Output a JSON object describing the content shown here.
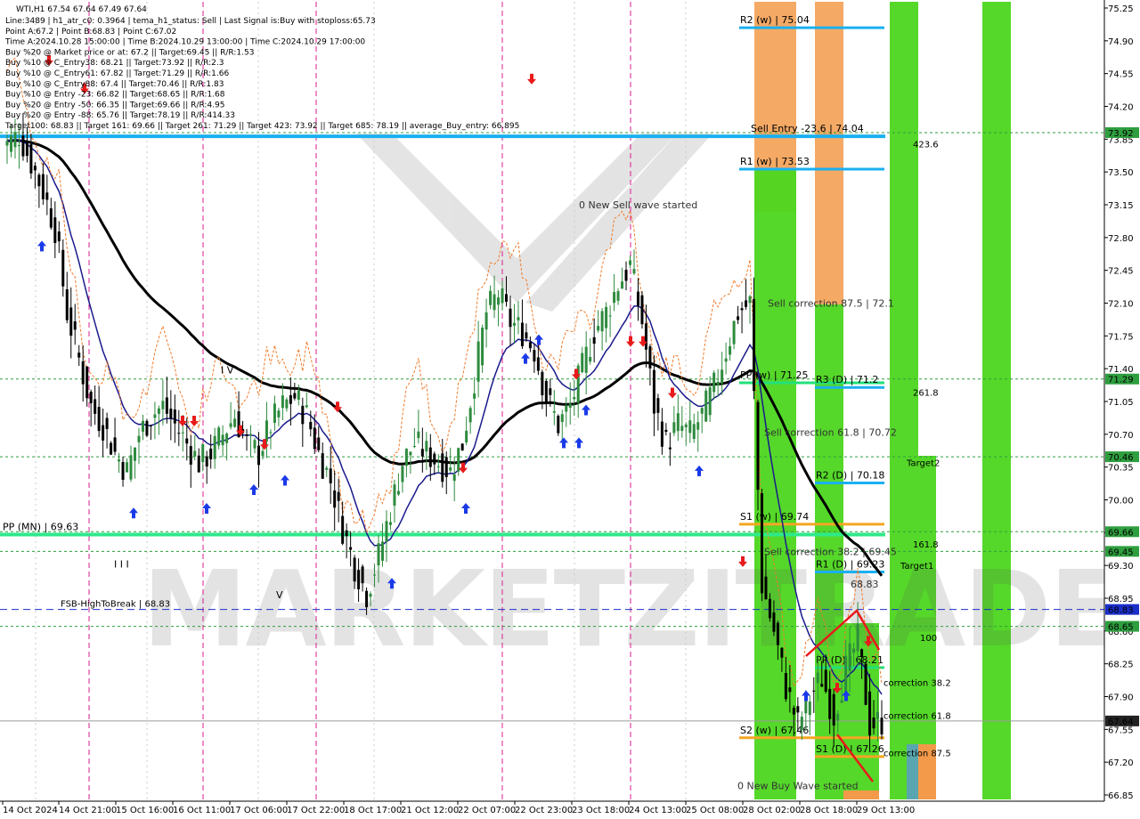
{
  "header": {
    "symbol_line": "WTI,H1 67.54 67.64 67.49 67.64",
    "info_lines": [
      "Line:3489 | h1_atr_c0: 0.3964 | tema_h1_status: Sell | Last Signal is:Buy with stoploss:65.73",
      "Point A:67.2 | Point B:68.83 | Point C:67.02",
      "Time A:2024.10.28 15:00:00 | Time B:2024.10.29 13:00:00 | Time C:2024.10.29 17:00:00",
      "Buy %20 @ Market price or at: 67.2 || Target:69.45 || R/R:1.53",
      "Buy %10 @ C_Entry38: 68.21 || Target:73.92 || R/R:2.3",
      "Buy %10 @ C_Entry61: 67.82 || Target:71.29 || R/R:1.66",
      "Buy %10 @ C_Entry88: 67.4 || Target:70.46 || R/R:1.83",
      "Buy %10 @ Entry -23: 66.82 || Target:68.65 || R/R:1.68",
      "Buy %20 @ Entry -50: 66.35 || Target:69.66 || R/R:4.95",
      "Buy %20 @ Entry -88: 65.76 || Target:78.19 || R/R:414.33",
      "Target100: 68.83 || Target 161: 69.66 || Target 261: 71.29 || Target 423: 73.92 || Target 685: 78.19 || average_Buy_entry: 66.895"
    ]
  },
  "chart_data": {
    "type": "candlestick",
    "instrument": "WTI",
    "timeframe": "H1",
    "price_axis": {
      "ticks": [
        75.25,
        74.9,
        74.55,
        74.2,
        73.85,
        73.5,
        73.15,
        72.8,
        72.45,
        72.1,
        71.75,
        71.4,
        71.05,
        70.7,
        70.35,
        70.0,
        69.65,
        69.3,
        68.95,
        68.6,
        68.25,
        67.9,
        67.55,
        67.2,
        66.85
      ],
      "range": [
        66.85,
        75.25
      ]
    },
    "time_axis": {
      "labels": [
        "14 Oct 2024",
        "14 Oct 21:00",
        "15 Oct 16:00",
        "16 Oct 11:00",
        "17 Oct 06:00",
        "17 Oct 22:00",
        "18 Oct 17:00",
        "21 Oct 12:00",
        "22 Oct 07:00",
        "22 Oct 23:00",
        "23 Oct 18:00",
        "24 Oct 13:00",
        "25 Oct 08:00",
        "28 Oct 02:00",
        "28 Oct 18:00",
        "29 Oct 13:00"
      ]
    },
    "close_series": [
      73.8,
      73.9,
      73.6,
      73.3,
      72.9,
      72.0,
      71.5,
      71.0,
      70.8,
      70.5,
      70.3,
      70.7,
      70.9,
      71.0,
      70.8,
      70.6,
      70.4,
      70.5,
      70.7,
      70.9,
      70.6,
      70.5,
      70.8,
      71.0,
      71.1,
      70.9,
      70.5,
      70.2,
      69.7,
      69.3,
      69.0,
      69.4,
      69.9,
      70.4,
      70.6,
      70.5,
      70.4,
      70.3,
      70.6,
      71.3,
      72.0,
      72.2,
      71.9,
      71.8,
      71.6,
      71.1,
      70.8,
      71.0,
      71.4,
      71.8,
      72.0,
      72.3,
      72.5,
      71.9,
      71.0,
      70.6,
      70.8,
      70.7,
      70.9,
      71.2,
      71.6,
      72.0,
      72.1,
      69.1,
      68.6,
      68.0,
      67.6,
      67.9,
      68.1,
      67.7,
      68.2,
      68.5,
      67.6,
      67.64
    ],
    "horizontal_levels": [
      {
        "label": "R2 (w) | 75.04",
        "value": 75.04,
        "color": "#1ab0f0"
      },
      {
        "label": "R1 (w) | 73.53",
        "value": 73.53,
        "color": "#1ab0f0"
      },
      {
        "label": "PP (w) | 71.25",
        "value": 71.25,
        "color": "#22e07a"
      },
      {
        "label": "R3 (D) | 71.2",
        "value": 71.2,
        "color": "#1ab0f0"
      },
      {
        "label": "R2 (D) | 70.18",
        "value": 70.18,
        "color": "#1ab0f0"
      },
      {
        "label": "S1 (w) | 69.74",
        "value": 69.74,
        "color": "#f5a623"
      },
      {
        "label": "R1 (D) | 69.23",
        "value": 69.23,
        "color": "#1ab0f0"
      },
      {
        "label": "PP (D) | 68.21",
        "value": 68.21,
        "color": "#22e07a"
      },
      {
        "label": "S2 (w) | 67.46",
        "value": 67.46,
        "color": "#f5a623"
      },
      {
        "label": "S1 (D) | 67.26",
        "value": 67.26,
        "color": "#f5a623"
      }
    ],
    "wide_lines": [
      {
        "label": "PP (MN) | 69.63",
        "value": 69.63,
        "color": "#2ee88a"
      },
      {
        "label": "Sell Entry -23.6 | 74.04",
        "value": 73.88,
        "color": "#1ab0f0"
      }
    ],
    "dotted_levels": [
      73.92,
      71.29,
      70.46,
      69.66,
      69.45,
      68.65
    ],
    "dashed_level": {
      "label": "FSB-HighToBreak | 68.83",
      "value": 68.83
    },
    "price_badges": [
      {
        "label": "73.92",
        "value": 73.92,
        "color": "#2e9e3e"
      },
      {
        "label": "71.29",
        "value": 71.29,
        "color": "#2e9e3e"
      },
      {
        "label": "70.46",
        "value": 70.46,
        "color": "#2e9e3e"
      },
      {
        "label": "69.66",
        "value": 69.66,
        "color": "#2e9e3e"
      },
      {
        "label": "69.45",
        "value": 69.45,
        "color": "#2e9e3e"
      },
      {
        "label": "68.83",
        "value": 68.83,
        "color": "#1a2ec8"
      },
      {
        "label": "68.65",
        "value": 68.65,
        "color": "#2e9e3e"
      },
      {
        "label": "67.64",
        "value": 67.64,
        "color": "#222222"
      }
    ],
    "annotations": [
      {
        "text": "0 New Sell wave started",
        "price": 73.15
      },
      {
        "text": "Sell correction 87.5 | 72.1",
        "price": 72.1
      },
      {
        "text": "Sell correction 61.8 | 70.72",
        "price": 70.72
      },
      {
        "text": "Sell correction 38.2 | 69.45",
        "price": 69.45
      },
      {
        "text": "68.83",
        "price": 69.1
      },
      {
        "text": "correction 38.2",
        "price": 68.05
      },
      {
        "text": "correction 61.8",
        "price": 67.7
      },
      {
        "text": "correction 87.5",
        "price": 67.3
      },
      {
        "text": "0 New Buy Wave started",
        "price": 66.95
      }
    ],
    "target_labels": [
      {
        "text": "423.6",
        "price": 73.8
      },
      {
        "text": "261.8",
        "price": 71.15
      },
      {
        "text": "Target2",
        "price": 70.4
      },
      {
        "text": "161.8",
        "price": 69.53
      },
      {
        "text": "Target1",
        "price": 69.3
      },
      {
        "text": "100",
        "price": 68.53
      }
    ],
    "fib_marks": [
      "I V",
      "I I I",
      "V"
    ]
  },
  "watermark": {
    "text": "MARKETZITRADE"
  },
  "colors": {
    "bull_candle": "#2e8b3e",
    "bear_candle": "#000000",
    "ma_slow": "#000000",
    "ma_fast": "#1a1a8c",
    "orange_dashed": "#f07a2a",
    "buy_arrow": "#1a3ae8",
    "sell_arrow": "#e81a1a",
    "zone_green": "#4cd61e",
    "zone_orange": "#f29a4a",
    "zone_teal": "#5aa6b0",
    "magenta_vline": "#d81e8c"
  }
}
